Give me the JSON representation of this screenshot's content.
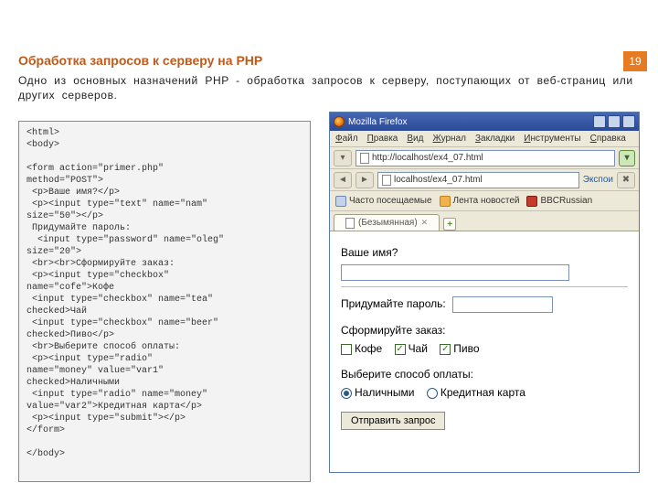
{
  "page_number": "19",
  "heading": "Обработка запросов к серверу на PHP",
  "intro": "Одно из основных назначений PHP - обработка запросов к серверу, поступающих от веб-страниц или других серверов.",
  "code": "<html>\n<body>\n\n<form action=\"primer.php\"\nmethod=\"POST\">\n <p>Ваше имя?</p>\n <p><input type=\"text\" name=\"nam\"\nsize=\"50\"></p>\n Придумайте пароль:\n  <input type=\"password\" name=\"oleg\"\nsize=\"20\">\n <br><br>Сформируйте заказ:\n <p><input type=\"checkbox\"\nname=\"cofe\">Кофе\n <input type=\"checkbox\" name=\"tea\"\nchecked>Чай\n <input type=\"checkbox\" name=\"beer\"\nchecked>Пиво</p>\n <br>Выберите способ оплаты:\n <p><input type=\"radio\"\nname=\"money\" value=\"var1\"\nchecked>Наличными\n <input type=\"radio\" name=\"money\"\nvalue=\"var2\">Кредитная карта</p>\n <p><input type=\"submit\"></p>\n</form>\n\n</body>",
  "browser": {
    "title": "Mozilla Firefox",
    "menu": [
      "Файл",
      "Правка",
      "Вид",
      "Журнал",
      "Закладки",
      "Инструменты",
      "Справка"
    ],
    "address_label": "http://localhost/ex4_07.html",
    "address_short": "localhost/ex4_07.html",
    "toolbar_extra": "Экспои",
    "bookmarks": [
      "Часто посещаемые",
      "Лента новостей",
      "BBCRussian"
    ],
    "form": {
      "q_name": "Ваше имя?",
      "q_pass": "Придумайте пароль:",
      "q_order": "Сформируйте заказ:",
      "opt_cofe": "Кофе",
      "opt_tea": "Чай",
      "opt_beer": "Пиво",
      "q_pay": "Выберите способ оплаты:",
      "pay_cash": "Наличными",
      "pay_card": "Кредитная карта",
      "submit": "Отправить запрос"
    }
  }
}
